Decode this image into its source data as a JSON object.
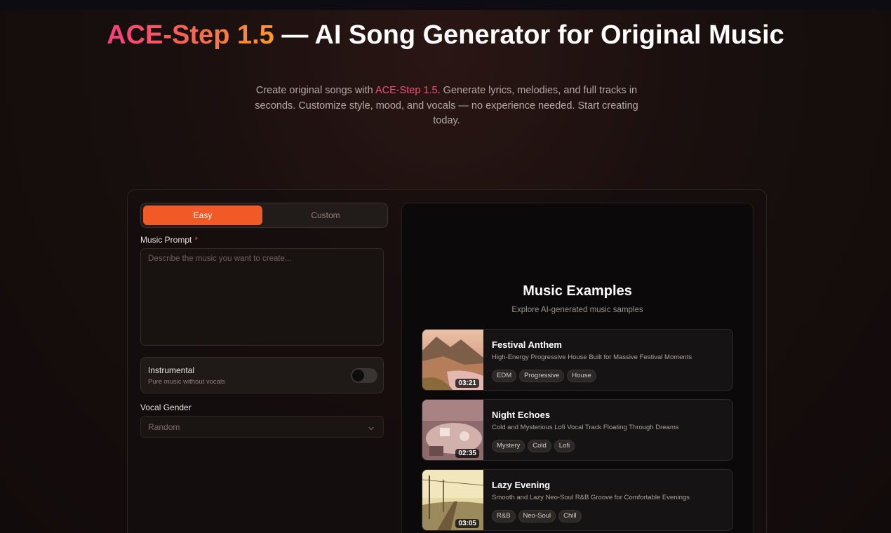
{
  "hero": {
    "title_brand": "ACE-Step 1.5",
    "title_rest": " — AI Song Generator for Original Music",
    "subtitle_pre": "Create original songs with ",
    "subtitle_brand": "ACE-Step 1.5",
    "subtitle_post": ". Generate lyrics, melodies, and full tracks in seconds. Customize style, mood, and vocals — no experience needed. Start creating today."
  },
  "form": {
    "modes": [
      "Easy",
      "Custom"
    ],
    "active_mode": "Easy",
    "prompt_label": "Music Prompt",
    "required_mark": "*",
    "prompt_placeholder": "Describe the music you want to create...",
    "prompt_value": "",
    "instrumental": {
      "title": "Instrumental",
      "description": "Pure music without vocals",
      "enabled": false
    },
    "vocal_gender": {
      "label": "Vocal Gender",
      "value": "Random"
    }
  },
  "examples": {
    "title": "Music Examples",
    "subtitle": "Explore AI-generated music samples",
    "tracks": [
      {
        "title": "Festival Anthem",
        "description": "High-Energy Progressive House Built for Massive Festival Moments",
        "duration": "03:21",
        "tags": [
          "EDM",
          "Progressive",
          "House"
        ]
      },
      {
        "title": "Night Echoes",
        "description": "Cold and Mysterious Lofi Vocal Track Floating Through Dreams",
        "duration": "02:35",
        "tags": [
          "Mystery",
          "Cold",
          "Lofi"
        ]
      },
      {
        "title": "Lazy Evening",
        "description": "Smooth and Lazy Neo-Soul R&B Groove for Comfortable Evenings",
        "duration": "03:05",
        "tags": [
          "R&B",
          "Neo-Soul",
          "Chill"
        ]
      }
    ]
  },
  "colors": {
    "accent": "#f15a27",
    "brand_gradient_start": "#f5407f",
    "brand_gradient_end": "#fb9a2c",
    "required": "#f04a3b"
  }
}
